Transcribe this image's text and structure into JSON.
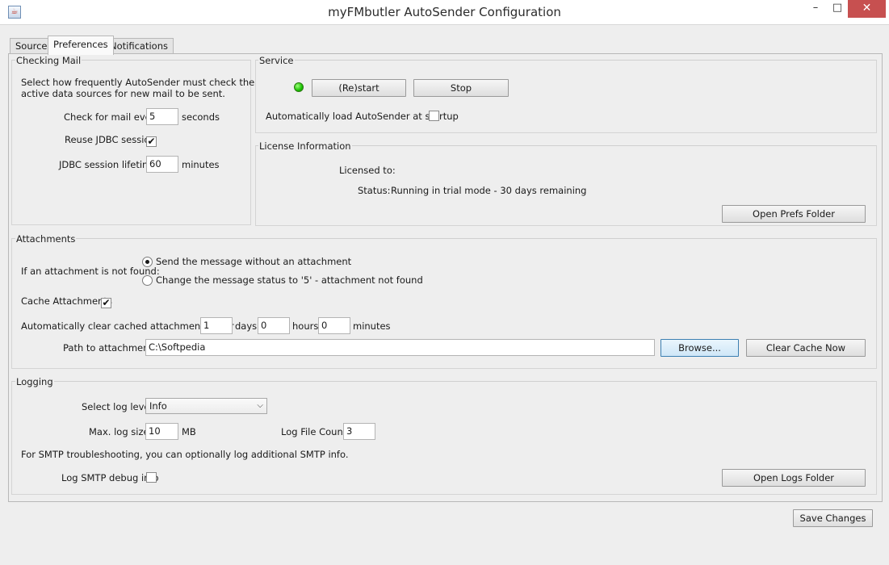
{
  "window": {
    "title": "myFMbutler AutoSender Configuration",
    "app_icon": "java-app-icon",
    "minimize_glyph": "–",
    "maximize_glyph": "□",
    "close_glyph": "✕"
  },
  "tabs": [
    {
      "label": "Sources",
      "selected": false
    },
    {
      "label": "Preferences",
      "selected": true
    },
    {
      "label": "Notifications",
      "selected": false
    }
  ],
  "checking_mail": {
    "title": "Checking Mail",
    "description_line1": "Select how frequently AutoSender must check the",
    "description_line2": "active data sources for new mail to be sent.",
    "check_label": "Check for mail every",
    "check_value": "5",
    "check_unit": "seconds",
    "reuse_label": "Reuse JDBC session",
    "reuse_checked": "✔",
    "lifetime_label": "JDBC session lifetime:",
    "lifetime_value": "60",
    "lifetime_unit": "minutes"
  },
  "service": {
    "title": "Service",
    "restart_label": "(Re)start",
    "stop_label": "Stop",
    "autoload_label": "Automatically load AutoSender at startup",
    "status_led_color": "#18c000"
  },
  "license": {
    "title": "License Information",
    "licensed_to_label": "Licensed to:",
    "status_label": "Status:",
    "status_value": "Running in trial mode - 30 days remaining",
    "open_prefs_label": "Open Prefs Folder"
  },
  "attachments": {
    "title": "Attachments",
    "not_found_label": "If an attachment is not found:",
    "option_send": "Send the message without an attachment",
    "option_change": "Change the message status to '5' - attachment not found",
    "cache_label": "Cache Attachments",
    "cache_checked": "✔",
    "clear_label": "Automatically clear cached attachments after",
    "days_value": "1",
    "days_unit": "days",
    "hours_value": "0",
    "hours_unit": "hours",
    "minutes_value": "0",
    "minutes_unit": "minutes",
    "path_label": "Path to attachments",
    "path_value": "C:\\Softpedia",
    "browse_label": "Browse...",
    "clear_cache_label": "Clear Cache Now"
  },
  "logging": {
    "title": "Logging",
    "level_label": "Select log level:",
    "level_value": "Info",
    "size_label": "Max. log size:",
    "size_value": "10",
    "size_unit": "MB",
    "count_label": "Log File Count:",
    "count_value": "3",
    "smtp_note": "For SMTP troubleshooting, you can optionally log additional SMTP info.",
    "smtp_debug_label": "Log SMTP debug info",
    "open_logs_label": "Open Logs Folder"
  },
  "footer": {
    "save_label": "Save Changes"
  }
}
